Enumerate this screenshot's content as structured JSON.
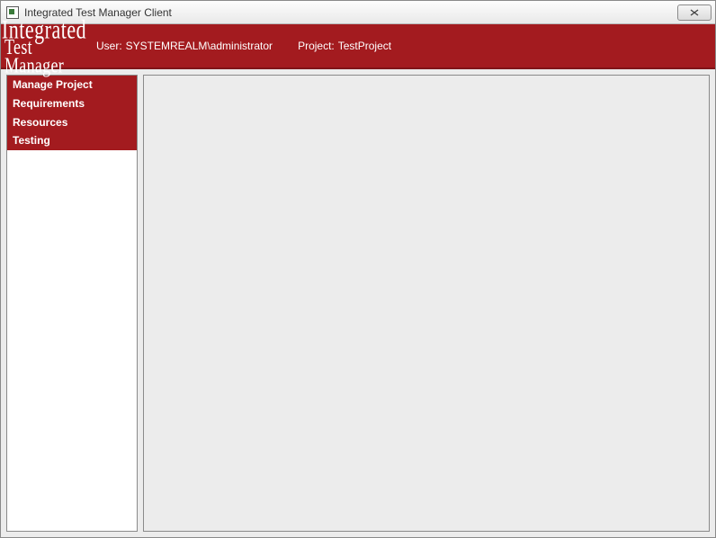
{
  "window": {
    "title": "Integrated Test Manager Client"
  },
  "logo": {
    "line1": "Integrated",
    "line2": "Test Manager"
  },
  "header": {
    "user_label": "User:",
    "user_value": "SYSTEMREALM\\administrator",
    "project_label": "Project:",
    "project_value": "TestProject"
  },
  "sidebar": {
    "items": [
      {
        "label": "Manage Project"
      },
      {
        "label": "Requirements"
      },
      {
        "label": "Resources"
      },
      {
        "label": "Testing"
      }
    ]
  }
}
